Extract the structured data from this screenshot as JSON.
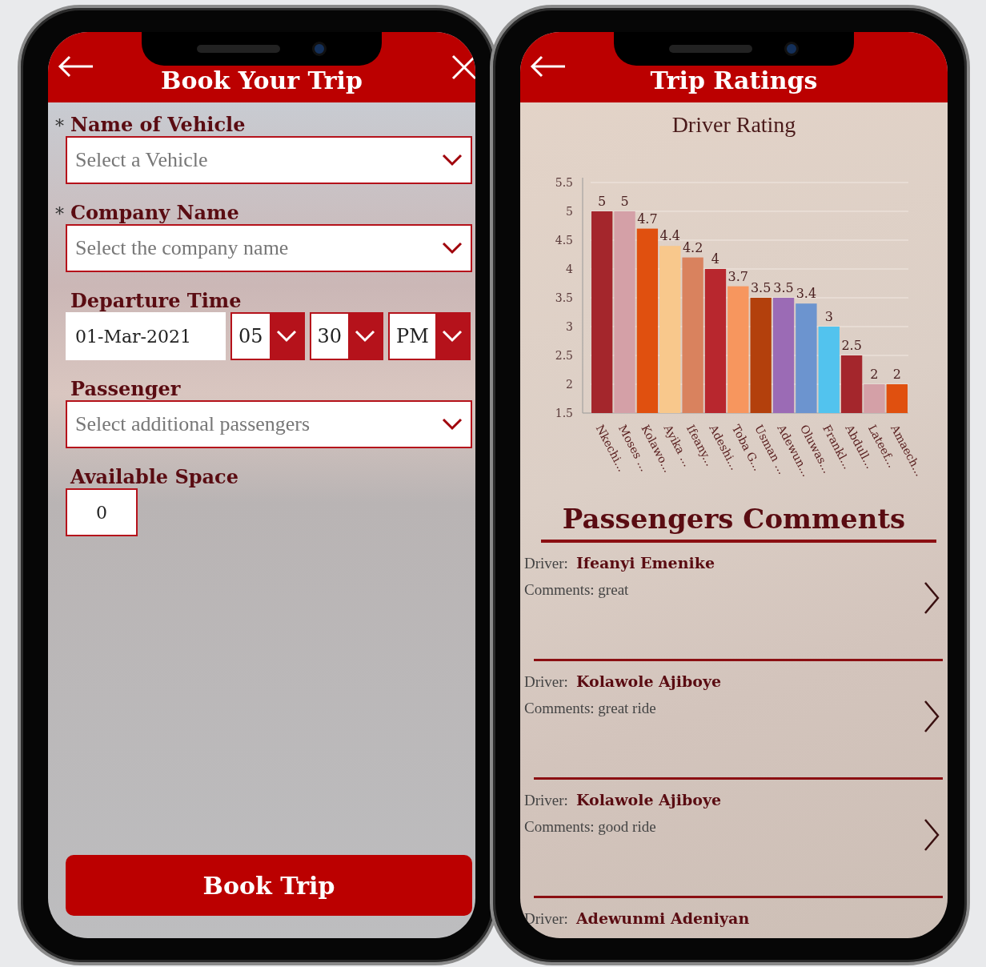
{
  "booking": {
    "title": "Book Your Trip",
    "required_mark": "*",
    "fields": [
      {
        "kind": "select",
        "label": "Name of  Vehicle",
        "required": true,
        "placeholder": "Select a Vehicle"
      },
      {
        "kind": "select",
        "label": "Company Name",
        "required": true,
        "placeholder": "Select the company name"
      },
      {
        "kind": "datetime",
        "label": "Departure Time",
        "required": false,
        "date": "01-Mar-2021",
        "hour": "05",
        "minute": "30",
        "period": "PM"
      },
      {
        "kind": "select",
        "label": "Passenger",
        "required": false,
        "placeholder": "Select additional passengers"
      },
      {
        "kind": "number",
        "label": "Available Space",
        "required": false,
        "value": "0"
      }
    ],
    "submit": "Book Trip"
  },
  "ratings": {
    "title": "Trip Ratings",
    "chart_data": {
      "type": "bar",
      "title": "Driver Rating",
      "categories": [
        "Nkechi...",
        "Moses ...",
        "Kolawo...",
        "Ayika ...",
        "Ifeany...",
        "Adeshi...",
        "Toba G...",
        "Usman ...",
        "Adewun...",
        "Oluwas...",
        "Frankl...",
        "Abdull...",
        "Lateef...",
        "Amaech..."
      ],
      "series": [
        {
          "values": [
            5,
            5,
            4.7,
            4.4,
            4.2,
            4,
            3.7,
            3.5,
            3.5,
            3.4,
            3,
            2.5,
            2,
            2
          ]
        }
      ],
      "colors": [
        "#a4262c",
        "#d4a0a7",
        "#e0500f",
        "#f8c88c",
        "#d9825e",
        "#b8272e",
        "#f7965e",
        "#b3400c",
        "#9b6bb5",
        "#6c94cf",
        "#52c3ee",
        "#a4262c",
        "#d4a0a7",
        "#e0500f"
      ],
      "ylim": [
        1.5,
        5.5
      ],
      "yticks": [
        1.5,
        2,
        2.5,
        3,
        3.5,
        4,
        4.5,
        5,
        5.5
      ],
      "grid": true,
      "data_labels": true
    },
    "comments_title": "Passengers Comments",
    "comments": [
      {
        "driver_label": "Driver:",
        "driver": "Ifeanyi Emenike",
        "comment_label": "Comments:",
        "comment": "great"
      },
      {
        "driver_label": "Driver:",
        "driver": "Kolawole Ajiboye",
        "comment_label": "Comments:",
        "comment": "great ride"
      },
      {
        "driver_label": "Driver:",
        "driver": "Kolawole Ajiboye",
        "comment_label": "Comments:",
        "comment": "good ride"
      },
      {
        "driver_label": "Driver:",
        "driver": "Adewunmi Adeniyan"
      }
    ]
  }
}
